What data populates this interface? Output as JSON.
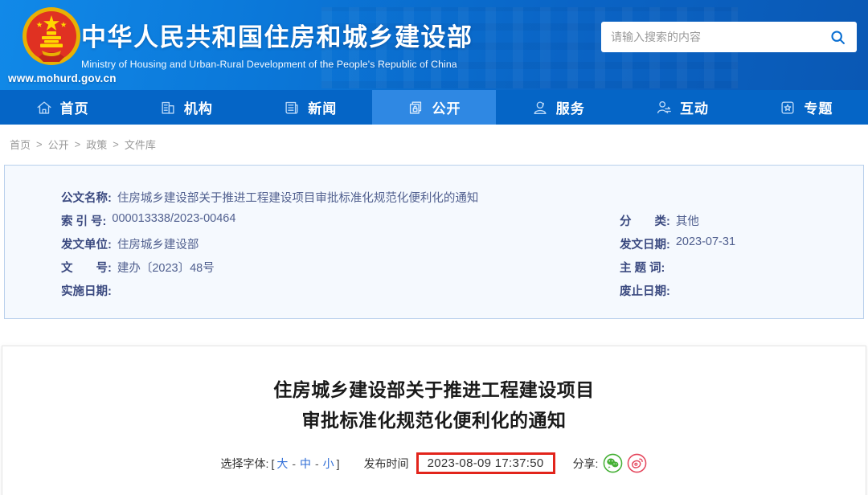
{
  "header": {
    "url": "www.mohurd.gov.cn",
    "title_cn": "中华人民共和国住房和城乡建设部",
    "title_en": "Ministry of Housing and Urban-Rural Development of the People's Republic of China",
    "search_placeholder": "请输入搜索的内容"
  },
  "nav": {
    "items": [
      {
        "label": "首页",
        "icon": "home-icon",
        "active": false
      },
      {
        "label": "机构",
        "icon": "organization-icon",
        "active": false
      },
      {
        "label": "新闻",
        "icon": "news-icon",
        "active": false
      },
      {
        "label": "公开",
        "icon": "disclosure-icon",
        "active": true
      },
      {
        "label": "服务",
        "icon": "service-icon",
        "active": false
      },
      {
        "label": "互动",
        "icon": "interaction-icon",
        "active": false
      },
      {
        "label": "专题",
        "icon": "topics-icon",
        "active": false
      }
    ]
  },
  "breadcrumb": {
    "separator": ">",
    "items": [
      "首页",
      "公开",
      "政策",
      "文件库"
    ]
  },
  "meta": {
    "doc_name_label": "公文名称:",
    "doc_name": "住房城乡建设部关于推进工程建设项目审批标准化规范化便利化的通知",
    "index_label": "索 引 号:",
    "index_value": "000013338/2023-00464",
    "category_label": "分　　类:",
    "category_value": "其他",
    "issuer_label": "发文单位:",
    "issuer_value": "住房城乡建设部",
    "issue_date_label": "发文日期:",
    "issue_date_value": "2023-07-31",
    "doc_no_label": "文　　号:",
    "doc_no_value": "建办〔2023〕48号",
    "keywords_label": "主 题 词:",
    "keywords_value": "",
    "effective_label": "实施日期:",
    "effective_value": "",
    "repeal_label": "废止日期:",
    "repeal_value": ""
  },
  "article": {
    "title_line1": "住房城乡建设部关于推进工程建设项目",
    "title_line2": "审批标准化规范化便利化的通知",
    "font_label": "选择字体:",
    "bracket_open": "[",
    "bracket_close": "]",
    "font_sep": "-",
    "font_sizes": [
      "大",
      "中",
      "小"
    ],
    "publish_label": "发布时间",
    "publish_time": "2023-08-09 17:37:50",
    "share_label": "分享:"
  },
  "colors": {
    "header_blue": "#0a6fd2",
    "nav_blue": "#0565C6",
    "active_tab_blue": "#2F88E3",
    "meta_bg": "#f5f9fe",
    "meta_border": "#b9d0ec",
    "highlight_red": "#e2241b",
    "wechat_green": "#45b035",
    "weibo_red": "#e5485e",
    "link_blue": "#2e6cd6"
  }
}
